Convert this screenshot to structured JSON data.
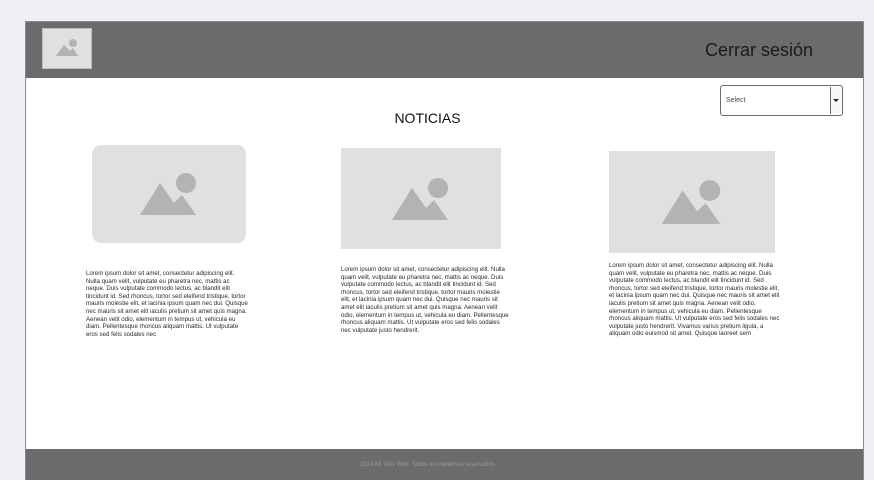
{
  "header": {
    "logo_icon": "image-placeholder-icon",
    "logout_label": "Cerrar sesión"
  },
  "main": {
    "title": "NOTICIAS",
    "select": {
      "value": "Select"
    },
    "cards": [
      {
        "image_icon": "image-placeholder-icon",
        "text": "Lorem ipsum dolor sit amet, consectetur adipiscing elit. Nulla quam velit, vulputate eu pharetra nec, mattis ac neque. Duis vulputate commodo lectus, ac blandit elit tincidunt id. Sed rhoncus, tortor sed eleifend tristique, tortor mauris molestie elit, et lacinia ipsum quam nec dui. Quisque nec mauris sit amet elit iaculis pretium sit amet quis magna. Aenean velit odio, elementum in tempus ut, vehicula eu diam. Pellentesque rhoncus aliquam mattis. Ut vulputate eros sed felis sodales nec"
      },
      {
        "image_icon": "image-placeholder-icon",
        "text": "Lorem ipsum dolor sit amet, consectetur adipiscing elit. Nulla quam velit, vulputate eu pharetra nec, mattis ac neque. Duis vulputate commodo lectus, ac blandit elit tincidunt id. Sed rhoncus, tortor sed eleifend tristique, tortor mauris molestie elit, et lacinia ipsum quam nec dui. Quisque nec mauris sit amet elit iaculis pretium sit amet quis magna. Aenean velit odio, elementum in tempus ut, vehicula eu diam. Pellentesque rhoncus aliquam mattis. Ut vulputate eros sed felis sodales nec vulputate justo hendrerit."
      },
      {
        "image_icon": "image-placeholder-icon",
        "text": "Lorem ipsum dolor sit amet, consectetur adipiscing elit. Nulla quam velit, vulputate eu pharetra nec, mattis ac neque. Duis vulputate commodo lectus, ac blandit elit tincidunt id. Sed rhoncus, tortor sed eleifend tristique, tortor mauris molestie elit, et lacinia ipsum quam nec dui. Quisque nec mauris sit amet elit iaculis pretium sit amet quis magna. Aenean velit odio, elementum in tempus ut, vehicula eu diam. Pellentesque rhoncus aliquam mattis. Ut vulputate eros sed felis sodales nec vulputate justo hendrerit. Vivamus varius pretium ligula, a aliquam odio euismod sit amet. Quisque laoreet sem"
      }
    ]
  },
  "footer": {
    "text": "2024 Mi Sitio Web. Todos los derechos reservados"
  },
  "colors": {
    "header_bg": "#6b6b6b",
    "placeholder_bg": "#e0e0e0",
    "placeholder_icon": "#b3b3b3"
  }
}
